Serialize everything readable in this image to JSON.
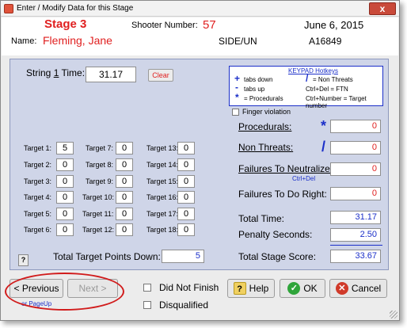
{
  "window": {
    "title": "Enter / Modify Data for this Stage",
    "close_label": "x"
  },
  "header": {
    "stage": "Stage  3",
    "shooter_number_label": "Shooter Number:",
    "shooter_number": "57",
    "date": "June  6, 2015",
    "name_label": "Name:",
    "name": "Fleming, Jane",
    "division": "SIDE/UN",
    "member_id": "A16849"
  },
  "string_time": {
    "label_pre": "String ",
    "label_num": "1",
    "label_post": " Time:",
    "value": "31.17",
    "clear_label": "Clear"
  },
  "keypad": {
    "title": "KEYPAD Hotkeys",
    "items": [
      {
        "key": "+",
        "desc": "tabs down"
      },
      {
        "key": "-",
        "desc": "tabs up"
      },
      {
        "key": "*",
        "desc": "= Procedurals"
      },
      {
        "key": "/",
        "desc": "= Non Threats"
      },
      {
        "key": "",
        "desc": "Ctrl+Del = FTN"
      },
      {
        "key": "",
        "desc": "Ctrl+Number = Target number"
      }
    ]
  },
  "finger_violation_label": "Finger violation",
  "targets": [
    {
      "label": "Target 1:",
      "value": "5"
    },
    {
      "label": "Target 2:",
      "value": "0"
    },
    {
      "label": "Target 3:",
      "value": "0"
    },
    {
      "label": "Target 4:",
      "value": "0"
    },
    {
      "label": "Target 5:",
      "value": "0"
    },
    {
      "label": "Target 6:",
      "value": "0"
    },
    {
      "label": "Target 7:",
      "value": "0"
    },
    {
      "label": "Target 8:",
      "value": "0"
    },
    {
      "label": "Target 9:",
      "value": "0"
    },
    {
      "label": "Target 10:",
      "value": "0"
    },
    {
      "label": "Target 11:",
      "value": "0"
    },
    {
      "label": "Target 12:",
      "value": "0"
    },
    {
      "label": "Target 13:",
      "value": "0"
    },
    {
      "label": "Target 14:",
      "value": "0"
    },
    {
      "label": "Target 15:",
      "value": "0"
    },
    {
      "label": "Target 16:",
      "value": "0"
    },
    {
      "label": "Target 17:",
      "value": "0"
    },
    {
      "label": "Target 18:",
      "value": "0"
    }
  ],
  "penalties": {
    "procedurals": {
      "label": "Procedurals:",
      "symbol": "*",
      "value": "0"
    },
    "non_threats": {
      "label": "Non Threats:",
      "symbol": "/",
      "value": "0"
    },
    "ftn": {
      "label": "Failures To Neutralize:",
      "hint": "Ctrl+Del",
      "value": "0"
    },
    "ftdr": {
      "label": "Failures To Do Right:",
      "value": "0"
    }
  },
  "totals": {
    "total_target_points_down_label": "Total Target Points Down:",
    "total_target_points_down": "5",
    "total_time_label": "Total Time:",
    "total_time": "31.17",
    "penalty_seconds_label": "Penalty Seconds:",
    "penalty_seconds": "2.50",
    "total_stage_score_label": "Total Stage Score:",
    "total_stage_score": "33.67"
  },
  "buttons": {
    "help_q": "?",
    "previous": "< Previous",
    "next": "Next >",
    "pageup_hint": "or PageUp",
    "did_not_finish": "Did Not Finish",
    "disqualified": "Disqualified",
    "help": "Help",
    "ok": "OK",
    "cancel": "Cancel"
  },
  "colors": {
    "accent_red": "#e02020",
    "accent_blue": "#1b2fc9",
    "panel": "#cfd5e8"
  },
  "icons": [
    "app-icon",
    "close-icon",
    "help-icon",
    "ok-check-icon",
    "cancel-x-icon"
  ]
}
